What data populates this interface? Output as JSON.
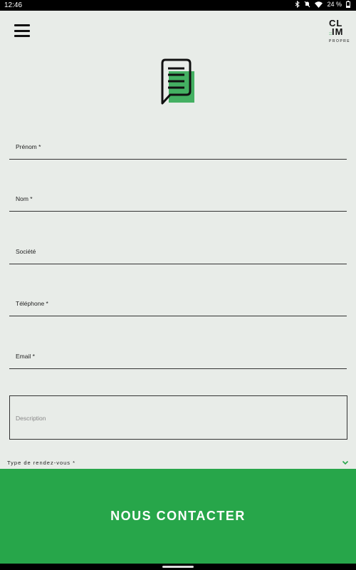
{
  "status_bar": {
    "time": "12:46",
    "battery": "24 %"
  },
  "header": {
    "logo_top": "CL",
    "logo_mid": "IM",
    "logo_bottom": "PROPRE"
  },
  "form": {
    "first_name_label": "Prénom *",
    "last_name_label": "Nom *",
    "company_label": "Société",
    "phone_label": "Téléphone *",
    "email_label": "Email *",
    "description_placeholder": "Description",
    "appointment_type_label": "Type de rendez-vous *"
  },
  "cta": {
    "label": "NOUS CONTACTER"
  },
  "colors": {
    "accent": "#27a64a",
    "background": "#e8ece8",
    "text": "#111111"
  },
  "icons": [
    "menu-icon",
    "message-document-icon",
    "chevron-down-icon",
    "bluetooth-icon",
    "mute-icon",
    "wifi-icon",
    "battery-icon"
  ]
}
